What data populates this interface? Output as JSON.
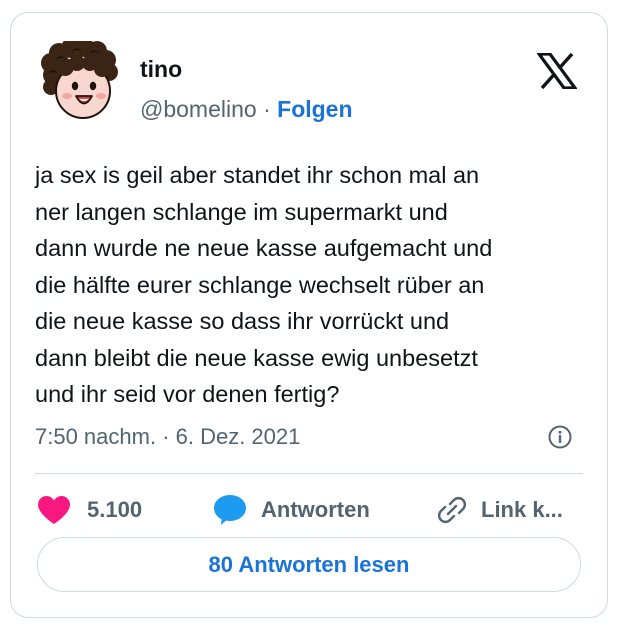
{
  "author": {
    "name": "tino",
    "handle": "@bomelino",
    "separator": "·",
    "follow_label": "Folgen",
    "avatar_icon": "cartoon-face-curly-hair"
  },
  "brand_icon": "x-logo-icon",
  "tweet": {
    "text": "ja sex is geil aber standet ihr schon mal an\nner langen schlange im supermarkt und\ndann wurde ne neue kasse aufgemacht und\ndie hälfte eurer schlange wechselt rüber an\ndie neue kasse so dass ihr vorrückt und\ndann bleibt die neue kasse ewig unbesetzt\nund ihr seid vor denen fertig?",
    "timestamp": "7:50 nachm. · 6. Dez. 2021"
  },
  "actions": {
    "like_count": "5.100",
    "reply_label": "Antworten",
    "link_label": "Link k..."
  },
  "read_replies_label": "80 Antworten lesen",
  "colors": {
    "like": "#f91880",
    "reply": "#1d9bf0",
    "link_accent": "#1a73d9",
    "border": "#cfd9de",
    "secondary_text": "#536471"
  }
}
